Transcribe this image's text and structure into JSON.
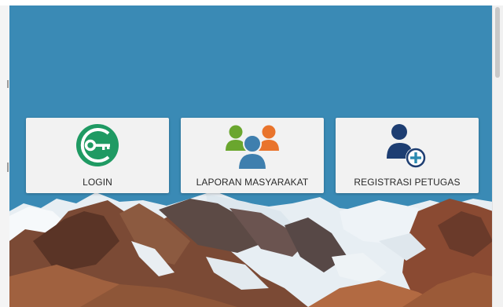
{
  "menu": {
    "items": [
      {
        "label": "LOGIN",
        "icon": "key-icon"
      },
      {
        "label": "LAPORAN MASYARAKAT",
        "icon": "people-group-icon"
      },
      {
        "label": "REGISTRASI PETUGAS",
        "icon": "add-user-icon"
      }
    ]
  },
  "colors": {
    "sky": "#3a8ab5",
    "key_green": "#1f9a63",
    "person_green": "#6aa62e",
    "person_orange": "#e9742c",
    "person_blue": "#3f7fae",
    "user_navy": "#1e3e72",
    "add_teal": "#2a8ab0"
  }
}
